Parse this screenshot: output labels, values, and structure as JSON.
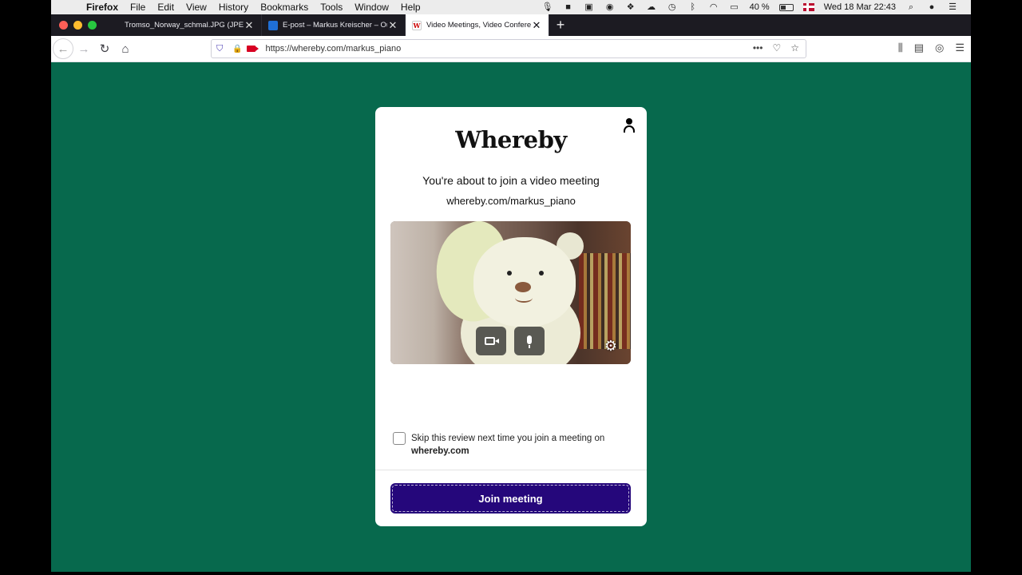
{
  "menubar": {
    "app_name": "Firefox",
    "menus": [
      "File",
      "Edit",
      "View",
      "History",
      "Bookmarks",
      "Tools",
      "Window",
      "Help"
    ],
    "battery_percent": "40 %",
    "datetime": "Wed 18 Mar  22:43"
  },
  "tabs": [
    {
      "title": "Tromso_Norway_schmal.JPG (JPEG",
      "active": false
    },
    {
      "title": "E-post – Markus Kreischer – Ou",
      "active": false
    },
    {
      "title": "Video Meetings, Video Confere",
      "active": true
    }
  ],
  "navbar": {
    "url": "https://whereby.com/markus_piano"
  },
  "card": {
    "logo": "Whereby",
    "headline": "You're about to join a video meeting",
    "meeting_url": "whereby.com/markus_piano",
    "skip_text": "Skip this review next time you join a meeting on",
    "skip_domain": "whereby.com",
    "skip_checked": false,
    "join_label": "Join meeting"
  },
  "colors": {
    "page_background": "#07694d",
    "join_button": "#25077b"
  }
}
